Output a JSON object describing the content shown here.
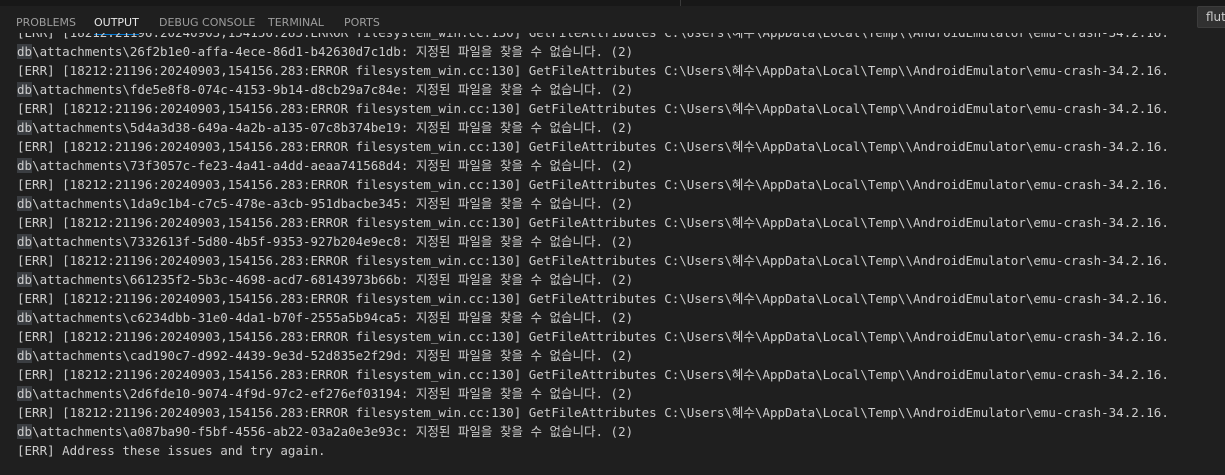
{
  "tabs": [
    {
      "label": "PROBLEMS",
      "active": false
    },
    {
      "label": "OUTPUT",
      "active": true
    },
    {
      "label": "DEBUG CONSOLE",
      "active": false
    },
    {
      "label": "TERMINAL",
      "active": false
    },
    {
      "label": "PORTS",
      "active": false
    }
  ],
  "channel": {
    "label": "flutt"
  },
  "colors": {
    "background": "#1f1f1f",
    "text": "#cccccc",
    "active_tab_underline": "#0078d4",
    "highlight": "#3a3d41"
  },
  "output": {
    "error_prefix": "[ERR] [18212:21196:20240903,154156.283:ERROR filesystem_win.cc:130] GetFileAttributes C:\\Users\\혜수\\AppData\\Local\\Temp\\\\AndroidEmulator\\emu-crash-34.2.16.",
    "path_highlight": "db",
    "path_prefix": "\\attachments\\",
    "message_suffix": ": 지정된 파일을 찾을 수 없습니다. (2)",
    "attachment_ids": [
      "26f2b1e0-affa-4ece-86d1-b42630d7c1db",
      "fde5e8f8-074c-4153-9b14-d8cb29a7c84e",
      "5d4a3d38-649a-4a2b-a135-07c8b374be19",
      "73f3057c-fe23-4a41-a4dd-aeaa741568d4",
      "1da9c1b4-c7c5-478e-a3cb-951dbacbe345",
      "7332613f-5d80-4b5f-9353-927b204e9ec8",
      "661235f2-5b3c-4698-acd7-68143973b66b",
      "c6234dbb-31e0-4da1-b70f-2555a5b94ca5",
      "cad190c7-d992-4439-9e3d-52d835e2f29d",
      "2d6fde10-9074-4f9d-97c2-ef276ef03194",
      "a087ba90-f5bf-4556-ab22-03a2a0e3e93c"
    ],
    "final_line": "[ERR] Address these issues and try again."
  }
}
